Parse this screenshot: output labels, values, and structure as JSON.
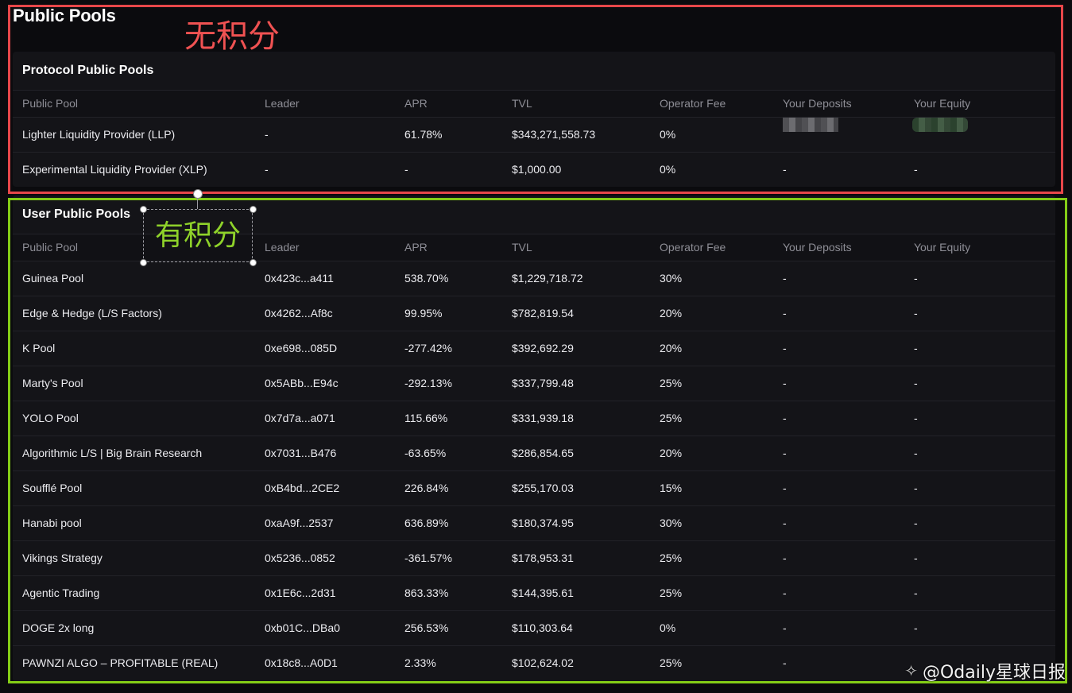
{
  "page": {
    "title": "Public Pools"
  },
  "columns": [
    "Public Pool",
    "Leader",
    "APR",
    "TVL",
    "Operator Fee",
    "Your Deposits",
    "Your Equity"
  ],
  "protocol": {
    "title": "Protocol Public Pools",
    "rows": [
      {
        "pool": "Lighter Liquidity Provider (LLP)",
        "leader": "-",
        "apr": "61.78%",
        "tvl": "$343,271,558.73",
        "fee": "0%",
        "deposits": "",
        "equity": ""
      },
      {
        "pool": "Experimental Liquidity Provider (XLP)",
        "leader": "-",
        "apr": "-",
        "tvl": "$1,000.00",
        "fee": "0%",
        "deposits": "-",
        "equity": "-"
      }
    ]
  },
  "user": {
    "title": "User Public Pools",
    "rows": [
      {
        "pool": "Guinea Pool",
        "leader": "0x423c...a411",
        "apr": "538.70%",
        "tvl": "$1,229,718.72",
        "fee": "30%",
        "deposits": "-",
        "equity": "-"
      },
      {
        "pool": "Edge & Hedge (L/S Factors)",
        "leader": "0x4262...Af8c",
        "apr": "99.95%",
        "tvl": "$782,819.54",
        "fee": "20%",
        "deposits": "-",
        "equity": "-"
      },
      {
        "pool": "K Pool",
        "leader": "0xe698...085D",
        "apr": "-277.42%",
        "tvl": "$392,692.29",
        "fee": "20%",
        "deposits": "-",
        "equity": "-"
      },
      {
        "pool": "Marty's Pool",
        "leader": "0x5ABb...E94c",
        "apr": "-292.13%",
        "tvl": "$337,799.48",
        "fee": "25%",
        "deposits": "-",
        "equity": "-"
      },
      {
        "pool": "YOLO Pool",
        "leader": "0x7d7a...a071",
        "apr": "115.66%",
        "tvl": "$331,939.18",
        "fee": "25%",
        "deposits": "-",
        "equity": "-"
      },
      {
        "pool": "Algorithmic L/S | Big Brain Research",
        "leader": "0x7031...B476",
        "apr": "-63.65%",
        "tvl": "$286,854.65",
        "fee": "20%",
        "deposits": "-",
        "equity": "-"
      },
      {
        "pool": "Soufflé Pool",
        "leader": "0xB4bd...2CE2",
        "apr": "226.84%",
        "tvl": "$255,170.03",
        "fee": "15%",
        "deposits": "-",
        "equity": "-"
      },
      {
        "pool": "Hanabi pool",
        "leader": "0xaA9f...2537",
        "apr": "636.89%",
        "tvl": "$180,374.95",
        "fee": "30%",
        "deposits": "-",
        "equity": "-"
      },
      {
        "pool": "Vikings Strategy",
        "leader": "0x5236...0852",
        "apr": "-361.57%",
        "tvl": "$178,953.31",
        "fee": "25%",
        "deposits": "-",
        "equity": "-"
      },
      {
        "pool": "Agentic Trading",
        "leader": "0x1E6c...2d31",
        "apr": "863.33%",
        "tvl": "$144,395.61",
        "fee": "25%",
        "deposits": "-",
        "equity": "-"
      },
      {
        "pool": "DOGE 2x long",
        "leader": "0xb01C...DBa0",
        "apr": "256.53%",
        "tvl": "$110,303.64",
        "fee": "0%",
        "deposits": "-",
        "equity": "-"
      },
      {
        "pool": "PAWNZI ALGO – PROFITABLE (REAL)",
        "leader": "0x18c8...A0D1",
        "apr": "2.33%",
        "tvl": "$102,624.02",
        "fee": "25%",
        "deposits": "-",
        "equity": ""
      }
    ]
  },
  "annotations": {
    "protocol_label": "无积分",
    "user_label": "有积分",
    "protocol_color": "#e8474a",
    "user_color": "#84cc16"
  },
  "watermark": {
    "icon": "diamond-logo-icon",
    "text": "@Odaily星球日报"
  }
}
